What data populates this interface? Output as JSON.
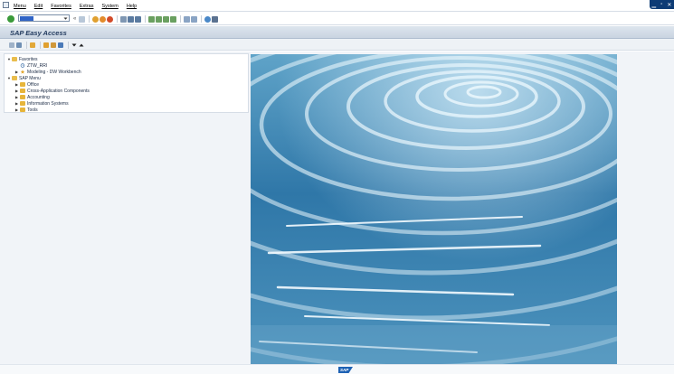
{
  "menubar": {
    "items": [
      "Menu",
      "Edit",
      "Favorites",
      "Extras",
      "System",
      "Help"
    ]
  },
  "toolbar": {
    "command_field_value": ""
  },
  "title": "SAP Easy Access",
  "tree": [
    {
      "label": "Favorites",
      "level": 0,
      "icon": "folder-open-icon",
      "expanded": true
    },
    {
      "label": "ZTW_RRI",
      "level": 1,
      "icon": "transaction-icon"
    },
    {
      "label": "Modeling - DW Workbench",
      "level": 1,
      "icon": "star-icon"
    },
    {
      "label": "SAP Menu",
      "level": 0,
      "icon": "folder-open-icon",
      "expanded": true
    },
    {
      "label": "Office",
      "level": 1,
      "icon": "folder-icon"
    },
    {
      "label": "Cross-Application Components",
      "level": 1,
      "icon": "folder-icon"
    },
    {
      "label": "Accounting",
      "level": 1,
      "icon": "folder-icon"
    },
    {
      "label": "Information Systems",
      "level": 1,
      "icon": "folder-icon"
    },
    {
      "label": "Tools",
      "level": 1,
      "icon": "folder-icon"
    }
  ],
  "footer": {
    "logo_text": "SAP"
  },
  "colors": {
    "title_text": "#223a5e",
    "logo_blue": "#1e62b4",
    "window_control": "#0d3b75"
  }
}
